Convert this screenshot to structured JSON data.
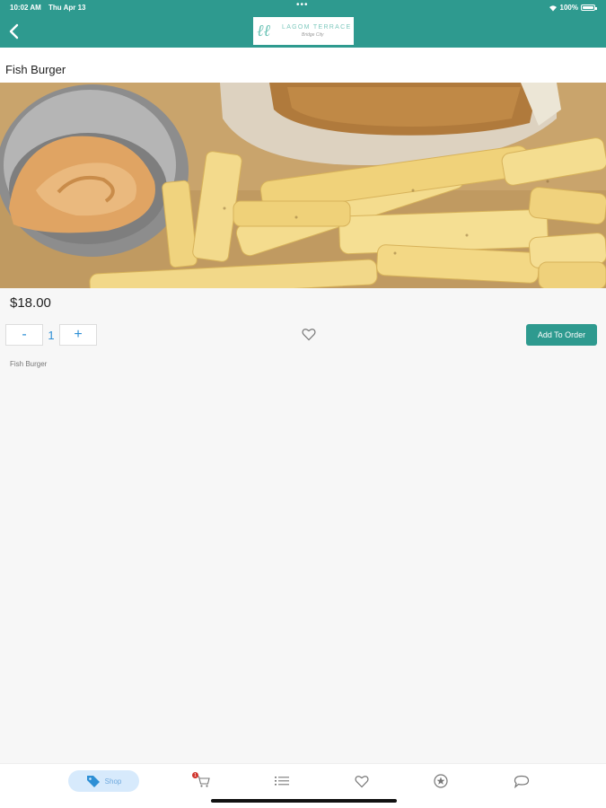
{
  "status_bar": {
    "time": "10:02 AM",
    "date": "Thu Apr 13",
    "dots": "•••",
    "battery": "100%"
  },
  "header": {
    "logo_name": "LAGOM TERRACE",
    "logo_tagline": "Bridge City"
  },
  "product": {
    "title": "Fish Burger",
    "price": "$18.00",
    "quantity": "1",
    "minus_label": "-",
    "plus_label": "+",
    "add_button_label": "Add To Order",
    "description": "Fish Burger"
  },
  "tabbar": {
    "shop_label": "Shop",
    "cart_badge": "1",
    "items": [
      "shop",
      "cart",
      "orders",
      "favorites",
      "rewards",
      "chat"
    ]
  },
  "colors": {
    "header": "#2e9a8f",
    "accent_blue": "#2d8fd5",
    "add_button": "#2e9a8f"
  }
}
